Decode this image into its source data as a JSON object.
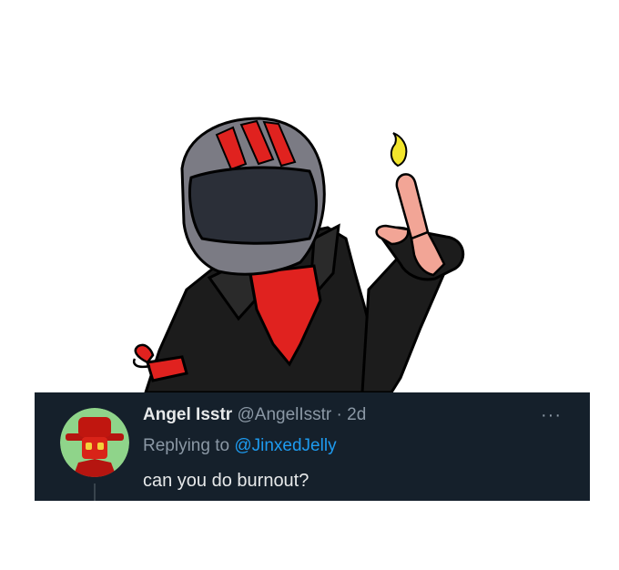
{
  "tweet": {
    "display_name": "Angel Isstr",
    "handle": "@AngelIsstr",
    "separator": "·",
    "time": "2d",
    "reply_prefix": "Replying to",
    "reply_mention": "@JinxedJelly",
    "text": "can you do burnout?",
    "more_label": "···"
  },
  "colors": {
    "tweet_bg": "#15202b",
    "mention": "#1d9bf0",
    "helmet": "#7b7b84",
    "stripe": "#e0221f",
    "visor": "#2b2f38",
    "flame": "#f2e52c"
  },
  "icons": [
    "more-options-icon",
    "avatar-image",
    "flame-icon"
  ]
}
